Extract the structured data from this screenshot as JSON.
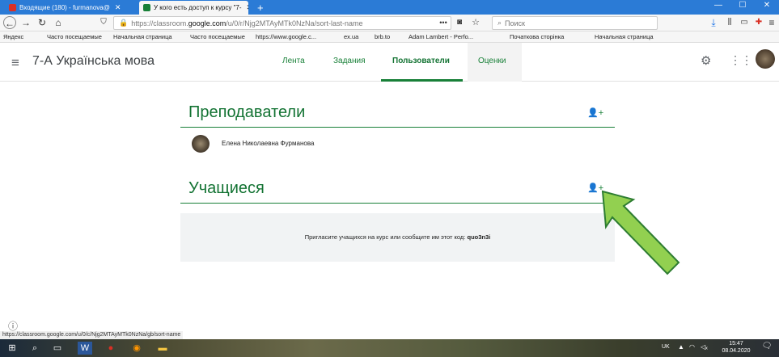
{
  "browser": {
    "tabs": [
      {
        "label": "Входящие (180) - furmanova@",
        "active": false,
        "icon_color": "#d93025"
      },
      {
        "label": "У кого есть доступ к курсу \"7-",
        "active": true,
        "icon_color": "#188038"
      }
    ],
    "new_tab": "+",
    "window_controls": [
      "—",
      "☐",
      "✕"
    ],
    "url_prefix": "https://classroom.",
    "url_domain": "google.com",
    "url_path": "/u/0/r/Njg2MTAyMTk0NzNa/sort-last-name",
    "url_dots": "•••",
    "search_placeholder": "Поиск",
    "nav_icons": [
      "back-arrow-icon",
      "forward-arrow-icon",
      "reload-icon",
      "home-icon"
    ],
    "right_icons": [
      "download-icon",
      "library-icon",
      "sidebar-icon",
      "extension-icon",
      "account-icon",
      "menu-icon"
    ]
  },
  "bookmarks": [
    "Яндекс",
    "Часто посещаемые",
    "Начальная страница",
    "Часто посещаемые",
    "https://www.google.c...",
    "ex.ua",
    "brb.to",
    "Adam Lambert - Perfo...",
    "Початкова сторінка",
    "Начальная страница"
  ],
  "app": {
    "course_title": "7-А Українська мова",
    "tabs": [
      {
        "label": "Лента"
      },
      {
        "label": "Задания"
      },
      {
        "label": "Пользователи"
      },
      {
        "label": "Оценки"
      }
    ],
    "active_tab": "Пользователи"
  },
  "teachers": {
    "title": "Преподаватели",
    "members": [
      {
        "name": "Елена Николаевна Фурманова"
      }
    ]
  },
  "students": {
    "title": "Учащиеся",
    "invite_text": "Пригласите учащихся на курс или сообщите им этот код:",
    "code": "quo3n3i"
  },
  "status_url": "https://classroom.google.com/u/0/c/Njg2MTAyMTk0NzNa/gb/sort-name",
  "taskbar": {
    "lang": "UK",
    "time": "15:47",
    "date": "08.04.2020"
  },
  "colors": {
    "accent": "#188038",
    "arrow_fill": "#92d050",
    "arrow_stroke": "#2e7d32"
  }
}
